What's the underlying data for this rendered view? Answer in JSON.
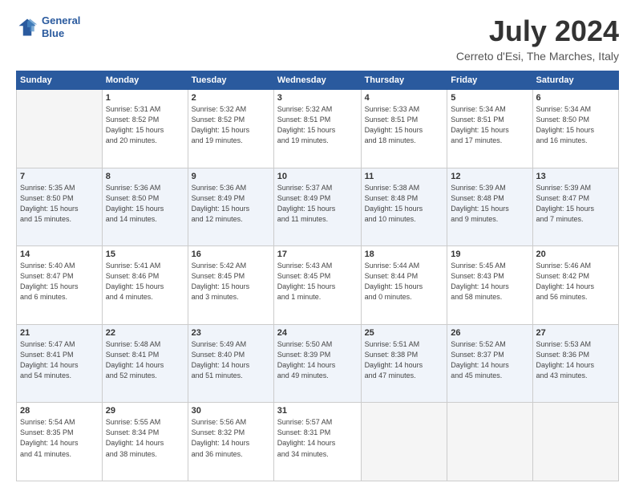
{
  "logo": {
    "line1": "General",
    "line2": "Blue"
  },
  "title": "July 2024",
  "subtitle": "Cerreto d'Esi, The Marches, Italy",
  "weekdays": [
    "Sunday",
    "Monday",
    "Tuesday",
    "Wednesday",
    "Thursday",
    "Friday",
    "Saturday"
  ],
  "weeks": [
    [
      {
        "day": "",
        "info": ""
      },
      {
        "day": "1",
        "info": "Sunrise: 5:31 AM\nSunset: 8:52 PM\nDaylight: 15 hours\nand 20 minutes."
      },
      {
        "day": "2",
        "info": "Sunrise: 5:32 AM\nSunset: 8:52 PM\nDaylight: 15 hours\nand 19 minutes."
      },
      {
        "day": "3",
        "info": "Sunrise: 5:32 AM\nSunset: 8:51 PM\nDaylight: 15 hours\nand 19 minutes."
      },
      {
        "day": "4",
        "info": "Sunrise: 5:33 AM\nSunset: 8:51 PM\nDaylight: 15 hours\nand 18 minutes."
      },
      {
        "day": "5",
        "info": "Sunrise: 5:34 AM\nSunset: 8:51 PM\nDaylight: 15 hours\nand 17 minutes."
      },
      {
        "day": "6",
        "info": "Sunrise: 5:34 AM\nSunset: 8:50 PM\nDaylight: 15 hours\nand 16 minutes."
      }
    ],
    [
      {
        "day": "7",
        "info": "Sunrise: 5:35 AM\nSunset: 8:50 PM\nDaylight: 15 hours\nand 15 minutes."
      },
      {
        "day": "8",
        "info": "Sunrise: 5:36 AM\nSunset: 8:50 PM\nDaylight: 15 hours\nand 14 minutes."
      },
      {
        "day": "9",
        "info": "Sunrise: 5:36 AM\nSunset: 8:49 PM\nDaylight: 15 hours\nand 12 minutes."
      },
      {
        "day": "10",
        "info": "Sunrise: 5:37 AM\nSunset: 8:49 PM\nDaylight: 15 hours\nand 11 minutes."
      },
      {
        "day": "11",
        "info": "Sunrise: 5:38 AM\nSunset: 8:48 PM\nDaylight: 15 hours\nand 10 minutes."
      },
      {
        "day": "12",
        "info": "Sunrise: 5:39 AM\nSunset: 8:48 PM\nDaylight: 15 hours\nand 9 minutes."
      },
      {
        "day": "13",
        "info": "Sunrise: 5:39 AM\nSunset: 8:47 PM\nDaylight: 15 hours\nand 7 minutes."
      }
    ],
    [
      {
        "day": "14",
        "info": "Sunrise: 5:40 AM\nSunset: 8:47 PM\nDaylight: 15 hours\nand 6 minutes."
      },
      {
        "day": "15",
        "info": "Sunrise: 5:41 AM\nSunset: 8:46 PM\nDaylight: 15 hours\nand 4 minutes."
      },
      {
        "day": "16",
        "info": "Sunrise: 5:42 AM\nSunset: 8:45 PM\nDaylight: 15 hours\nand 3 minutes."
      },
      {
        "day": "17",
        "info": "Sunrise: 5:43 AM\nSunset: 8:45 PM\nDaylight: 15 hours\nand 1 minute."
      },
      {
        "day": "18",
        "info": "Sunrise: 5:44 AM\nSunset: 8:44 PM\nDaylight: 15 hours\nand 0 minutes."
      },
      {
        "day": "19",
        "info": "Sunrise: 5:45 AM\nSunset: 8:43 PM\nDaylight: 14 hours\nand 58 minutes."
      },
      {
        "day": "20",
        "info": "Sunrise: 5:46 AM\nSunset: 8:42 PM\nDaylight: 14 hours\nand 56 minutes."
      }
    ],
    [
      {
        "day": "21",
        "info": "Sunrise: 5:47 AM\nSunset: 8:41 PM\nDaylight: 14 hours\nand 54 minutes."
      },
      {
        "day": "22",
        "info": "Sunrise: 5:48 AM\nSunset: 8:41 PM\nDaylight: 14 hours\nand 52 minutes."
      },
      {
        "day": "23",
        "info": "Sunrise: 5:49 AM\nSunset: 8:40 PM\nDaylight: 14 hours\nand 51 minutes."
      },
      {
        "day": "24",
        "info": "Sunrise: 5:50 AM\nSunset: 8:39 PM\nDaylight: 14 hours\nand 49 minutes."
      },
      {
        "day": "25",
        "info": "Sunrise: 5:51 AM\nSunset: 8:38 PM\nDaylight: 14 hours\nand 47 minutes."
      },
      {
        "day": "26",
        "info": "Sunrise: 5:52 AM\nSunset: 8:37 PM\nDaylight: 14 hours\nand 45 minutes."
      },
      {
        "day": "27",
        "info": "Sunrise: 5:53 AM\nSunset: 8:36 PM\nDaylight: 14 hours\nand 43 minutes."
      }
    ],
    [
      {
        "day": "28",
        "info": "Sunrise: 5:54 AM\nSunset: 8:35 PM\nDaylight: 14 hours\nand 41 minutes."
      },
      {
        "day": "29",
        "info": "Sunrise: 5:55 AM\nSunset: 8:34 PM\nDaylight: 14 hours\nand 38 minutes."
      },
      {
        "day": "30",
        "info": "Sunrise: 5:56 AM\nSunset: 8:32 PM\nDaylight: 14 hours\nand 36 minutes."
      },
      {
        "day": "31",
        "info": "Sunrise: 5:57 AM\nSunset: 8:31 PM\nDaylight: 14 hours\nand 34 minutes."
      },
      {
        "day": "",
        "info": ""
      },
      {
        "day": "",
        "info": ""
      },
      {
        "day": "",
        "info": ""
      }
    ]
  ]
}
